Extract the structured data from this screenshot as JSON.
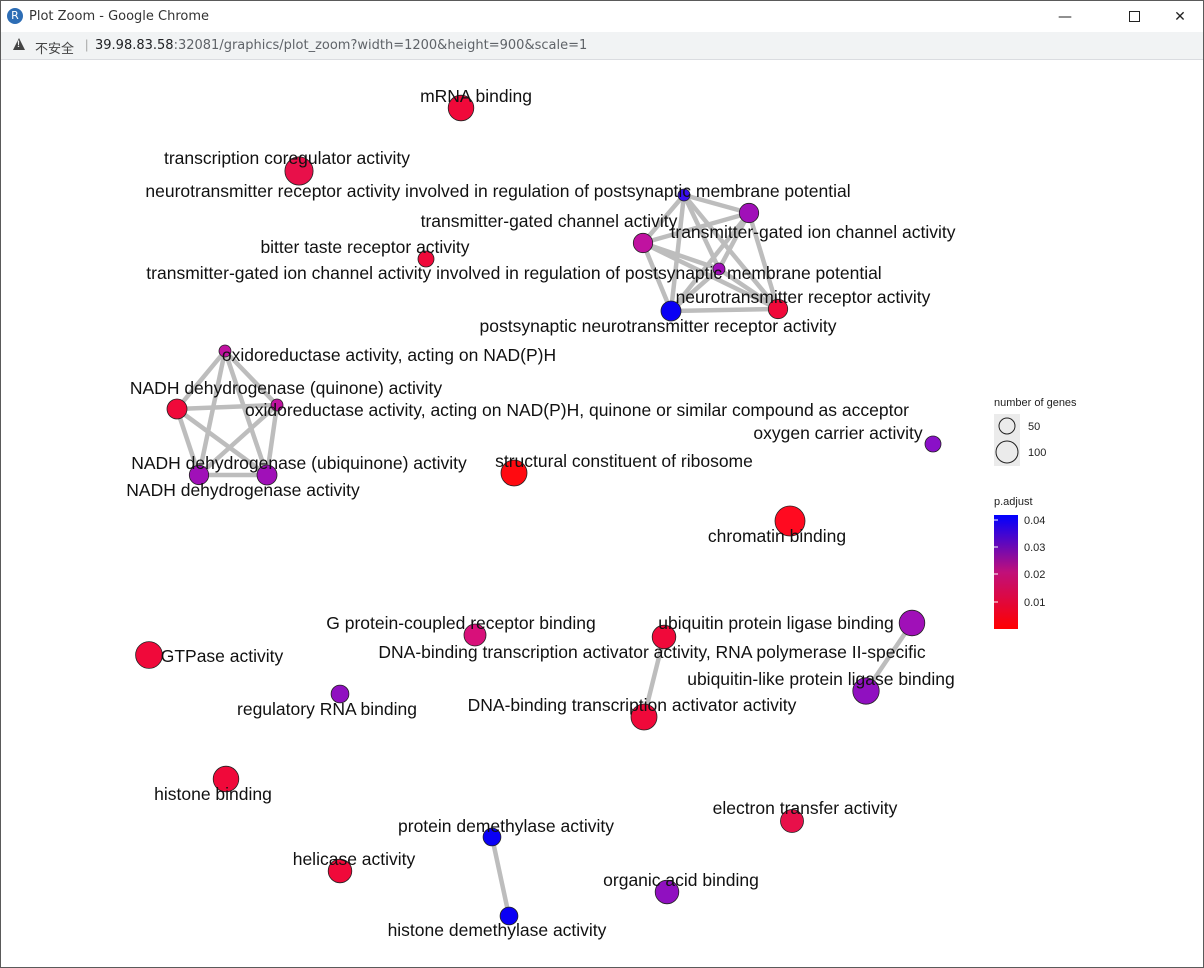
{
  "window": {
    "title": "Plot Zoom - Google Chrome",
    "app_icon": "R",
    "minimize_icon": "minimize-icon",
    "maximize_icon": "maximize-icon",
    "close_icon": "close-icon"
  },
  "address": {
    "security_label": "不安全",
    "host": "39.98.83.58",
    "path": ":32081/graphics/plot_zoom?width=1200&height=900&scale=1"
  },
  "legend": {
    "size_title": "number of genes",
    "size_items": [
      {
        "label": "50",
        "value": 50
      },
      {
        "label": "100",
        "value": 100
      }
    ],
    "color_title": "p.adjust",
    "color_ticks": [
      "0.04",
      "0.03",
      "0.02",
      "0.01"
    ],
    "color_high": "#0000ff",
    "color_low": "#ff0000"
  },
  "network": {
    "nodes": [
      {
        "id": "mrna",
        "label": "mRNA binding",
        "color": "#f0093a",
        "size": 95
      },
      {
        "id": "tco",
        "label": "transcription coregulator activity",
        "color": "#e8104a",
        "size": 125
      },
      {
        "id": "ntr_psm",
        "label": "neurotransmitter receptor activity involved in regulation of postsynaptic membrane potential",
        "color": "#3a10f0",
        "size": 5
      },
      {
        "id": "tgca",
        "label": "transmitter-gated channel activity",
        "color": "#c012a0",
        "size": 40
      },
      {
        "id": "tgica",
        "label": "transmitter-gated ion channel activity",
        "color": "#a010b8",
        "size": 40
      },
      {
        "id": "btra",
        "label": "bitter taste receptor activity",
        "color": "#f0093a",
        "size": 20
      },
      {
        "id": "tgica_psm",
        "label": "transmitter-gated ion channel activity involved in regulation of postsynaptic membrane potential",
        "color": "#a010b8",
        "size": 5
      },
      {
        "id": "ntra",
        "label": "neurotransmitter receptor activity",
        "color": "#f0093a",
        "size": 40
      },
      {
        "id": "pntra",
        "label": "postsynaptic neurotransmitter receptor activity",
        "color": "#0a00f5",
        "size": 45
      },
      {
        "id": "oxnadph",
        "label": "oxidoreductase activity, acting on NAD(P)H",
        "color": "#c012a0",
        "size": 5
      },
      {
        "id": "ndq",
        "label": "NADH dehydrogenase (quinone) activity",
        "color": "#f0093a",
        "size": 45
      },
      {
        "id": "oxquin",
        "label": "oxidoreductase activity, acting on NAD(P)H, quinone or similar compound as acceptor",
        "color": "#c012a0",
        "size": 5
      },
      {
        "id": "ndu",
        "label": "NADH dehydrogenase (ubiquinone) activity",
        "color": "#a010b8",
        "size": 40
      },
      {
        "id": "nda",
        "label": "NADH dehydrogenase activity",
        "color": "#a010b8",
        "size": 45
      },
      {
        "id": "scr",
        "label": "structural constituent of ribosome",
        "color": "#ff0a10",
        "size": 100
      },
      {
        "id": "oca",
        "label": "oxygen carrier activity",
        "color": "#8a10c8",
        "size": 20
      },
      {
        "id": "chrom",
        "label": "chromatin binding",
        "color": "#ff0a20",
        "size": 150
      },
      {
        "id": "gpcr",
        "label": "G protein-coupled receptor binding",
        "color": "#d8107a",
        "size": 60
      },
      {
        "id": "ubpl",
        "label": "ubiquitin protein ligase binding",
        "color": "#a010b8",
        "size": 95
      },
      {
        "id": "dbtaps",
        "label": "DNA-binding transcription activator activity, RNA polymerase II-specific",
        "color": "#f0093a",
        "size": 75
      },
      {
        "id": "gtp",
        "label": "GTPase activity",
        "color": "#f0093a",
        "size": 110
      },
      {
        "id": "ublpl",
        "label": "ubiquitin-like protein ligase binding",
        "color": "#9010c0",
        "size": 105
      },
      {
        "id": "rrna",
        "label": "regulatory RNA binding",
        "color": "#9010c0",
        "size": 30
      },
      {
        "id": "dbta",
        "label": "DNA-binding transcription activator activity",
        "color": "#f0093a",
        "size": 100
      },
      {
        "id": "hist",
        "label": "histone binding",
        "color": "#f0093a",
        "size": 95
      },
      {
        "id": "eta",
        "label": "electron transfer activity",
        "color": "#e8104a",
        "size": 70
      },
      {
        "id": "pdma",
        "label": "protein demethylase activity",
        "color": "#0a00f5",
        "size": 30
      },
      {
        "id": "heli",
        "label": "helicase activity",
        "color": "#f0093a",
        "size": 75
      },
      {
        "id": "oab",
        "label": "organic acid binding",
        "color": "#9010c0",
        "size": 75
      },
      {
        "id": "hdma",
        "label": "histone demethylase activity",
        "color": "#0a00f5",
        "size": 30
      }
    ],
    "edges": [
      [
        "ntr_psm",
        "tgica"
      ],
      [
        "ntr_psm",
        "tgca"
      ],
      [
        "ntr_psm",
        "tgica_psm"
      ],
      [
        "ntr_psm",
        "ntra"
      ],
      [
        "ntr_psm",
        "pntra"
      ],
      [
        "tgica",
        "tgca"
      ],
      [
        "tgica",
        "tgica_psm"
      ],
      [
        "tgica",
        "ntra"
      ],
      [
        "tgica",
        "pntra"
      ],
      [
        "tgca",
        "tgica_psm"
      ],
      [
        "tgca",
        "ntra"
      ],
      [
        "tgca",
        "pntra"
      ],
      [
        "tgica_psm",
        "ntra"
      ],
      [
        "tgica_psm",
        "pntra"
      ],
      [
        "ntra",
        "pntra"
      ],
      [
        "oxnadph",
        "ndq"
      ],
      [
        "oxnadph",
        "oxquin"
      ],
      [
        "oxnadph",
        "ndu"
      ],
      [
        "oxnadph",
        "nda"
      ],
      [
        "ndq",
        "oxquin"
      ],
      [
        "ndq",
        "ndu"
      ],
      [
        "ndq",
        "nda"
      ],
      [
        "oxquin",
        "ndu"
      ],
      [
        "oxquin",
        "nda"
      ],
      [
        "ndu",
        "nda"
      ],
      [
        "ubpl",
        "ublpl"
      ],
      [
        "dbtaps",
        "dbta"
      ],
      [
        "pdma",
        "hdma"
      ]
    ]
  }
}
